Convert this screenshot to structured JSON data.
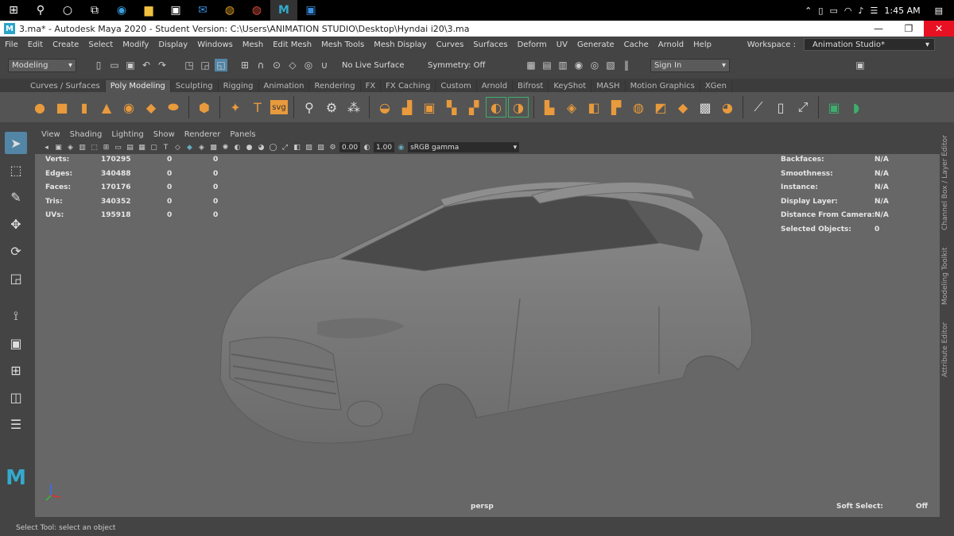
{
  "taskbar": {
    "time": "1:45 AM"
  },
  "window": {
    "title": "3.ma* - Autodesk Maya 2020 - Student Version: C:\\Users\\ANIMATION STUDIO\\Desktop\\Hyndai i20\\3.ma"
  },
  "menu": [
    "File",
    "Edit",
    "Create",
    "Select",
    "Modify",
    "Display",
    "Windows",
    "Mesh",
    "Edit Mesh",
    "Mesh Tools",
    "Mesh Display",
    "Curves",
    "Surfaces",
    "Deform",
    "UV",
    "Generate",
    "Cache",
    "Arnold",
    "Help"
  ],
  "workspace": {
    "label": "Workspace :",
    "value": "Animation Studio*"
  },
  "status": {
    "menuset": "Modeling",
    "live_surface": "No Live Surface",
    "symmetry": "Symmetry: Off",
    "sign_in": "Sign In"
  },
  "shelf_tabs": [
    "Curves / Surfaces",
    "Poly Modeling",
    "Sculpting",
    "Rigging",
    "Animation",
    "Rendering",
    "FX",
    "FX Caching",
    "Custom",
    "Arnold",
    "Bifrost",
    "KeyShot",
    "MASH",
    "Motion Graphics",
    "XGen"
  ],
  "shelf_text_icons": {
    "type": "T",
    "svg": "svg"
  },
  "viewport_menu": [
    "View",
    "Shading",
    "Lighting",
    "Show",
    "Renderer",
    "Panels"
  ],
  "viewport_tools": {
    "exposure": "0.00",
    "gamma": "1.00",
    "colorspace": "sRGB gamma"
  },
  "hud_left": [
    {
      "label": "Verts:",
      "v1": "170295",
      "v2": "0",
      "v3": "0"
    },
    {
      "label": "Edges:",
      "v1": "340488",
      "v2": "0",
      "v3": "0"
    },
    {
      "label": "Faces:",
      "v1": "170176",
      "v2": "0",
      "v3": "0"
    },
    {
      "label": "Tris:",
      "v1": "340352",
      "v2": "0",
      "v3": "0"
    },
    {
      "label": "UVs:",
      "v1": "195918",
      "v2": "0",
      "v3": "0"
    }
  ],
  "hud_right": [
    {
      "label": "Backfaces:",
      "value": "N/A"
    },
    {
      "label": "Smoothness:",
      "value": "N/A"
    },
    {
      "label": "Instance:",
      "value": "N/A"
    },
    {
      "label": "Display Layer:",
      "value": "N/A"
    },
    {
      "label": "Distance From Camera:",
      "value": "N/A"
    },
    {
      "label": "Selected Objects:",
      "value": "0"
    }
  ],
  "camera": "persp",
  "soft_select": {
    "label": "Soft Select:",
    "value": "Off"
  },
  "side_tabs": [
    "Channel Box / Layer Editor",
    "Modeling Toolkit",
    "Attribute Editor"
  ],
  "help_line": "Select Tool: select an object"
}
